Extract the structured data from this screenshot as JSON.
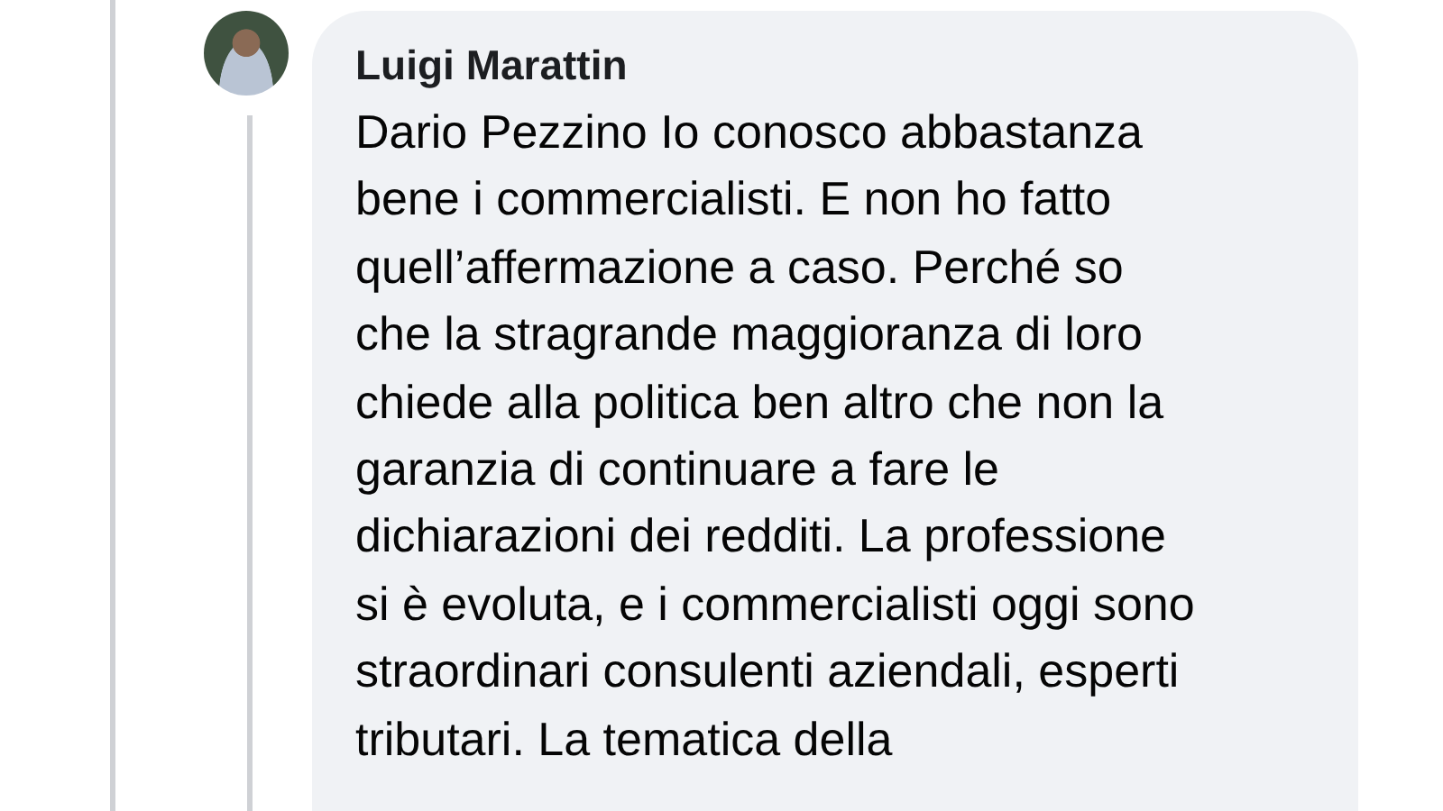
{
  "comment": {
    "author": "Luigi Marattin",
    "text": "Dario Pezzino Io conosco abbastanza\nbene i commercialisti. E non ho fatto\nquell’affermazione a caso. Perché so\nche la stragrande maggioranza di loro\nchiede alla politica ben altro che non la\ngaranzia di continuare a fare le\ndichiarazioni dei redditi. La professione\nsi è evoluta, e i commercialisti oggi sono\nstraordinari consulenti aziendali, esperti\ntributari. La tematica della"
  }
}
